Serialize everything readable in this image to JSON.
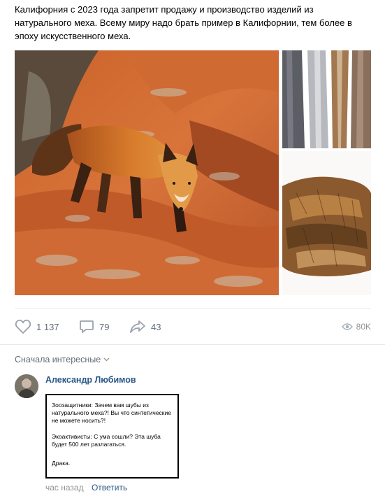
{
  "post": {
    "text": "Калифорния с 2023 года запретит продажу и производство изделий из натурального меха. Всему миру надо брать пример в Калифорнии, тем более в эпоху искусственного меха."
  },
  "actions": {
    "likes": "1 137",
    "comments": "79",
    "shares": "43",
    "views": "80K"
  },
  "comments_section": {
    "sort_label": "Сначала интересные",
    "comment": {
      "author": "Александр Любимов",
      "meme_lines": [
        "Зоозащитники: Зачем вам шубы из натурального меха?! Вы что синтетические не можете носить?!",
        "Экоактивисты: С ума сошли? Эта шуба будет 500 лет разлагаться.",
        "Драка."
      ],
      "time": "час назад",
      "reply_label": "Ответить"
    }
  },
  "icons": {
    "like": "heart-icon",
    "comment": "speech-bubble-icon",
    "share": "share-arrow-icon",
    "views": "eye-icon",
    "sort": "chevron-down-icon"
  },
  "colors": {
    "link": "#2a5885",
    "secondary": "#626d7a",
    "muted": "#939393",
    "divider": "#e7e8ec"
  }
}
